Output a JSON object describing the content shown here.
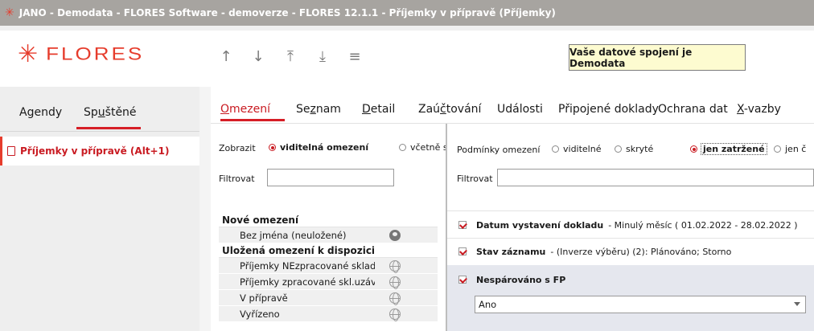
{
  "window": {
    "title": "JANO - Demodata - FLORES Software - demoverze - FLORES 12.1.1 - Příjemky v přípravě  (Příjemky)",
    "icon": "flores-asterisk-icon"
  },
  "header": {
    "logo_text": "FLORES",
    "brand_color": "#e63c2c",
    "nav_icons": [
      "arrow-up-icon",
      "arrow-down-icon",
      "arrow-top-icon",
      "arrow-bottom-icon",
      "menu-icon"
    ],
    "nav_glyphs": [
      "↑",
      "↓",
      "⤒",
      "⤓",
      "≡"
    ],
    "connection_notice": "Vaše datové spojení je Demodata"
  },
  "left": {
    "tabs": [
      {
        "label": "Agendy"
      },
      {
        "label_pre": "Sp",
        "label_u": "u",
        "label_post": "štěné",
        "active": true
      }
    ],
    "items": [
      {
        "label": "Příjemky v přípravě (Alt+1)",
        "icon": "document-icon"
      }
    ]
  },
  "tabs": [
    {
      "pre": "",
      "u": "O",
      "post": "mezení",
      "active": true
    },
    {
      "pre": "Se",
      "u": "z",
      "post": "nam"
    },
    {
      "pre": "",
      "u": "D",
      "post": "etail"
    },
    {
      "pre": "Zaú",
      "u": "č",
      "post": "tování"
    },
    {
      "pre": "Události",
      "u": "",
      "post": ""
    },
    {
      "pre": "Připojené doklady",
      "u": "",
      "post": ""
    },
    {
      "pre": "Ochrana dat",
      "u": "",
      "post": ""
    },
    {
      "pre": "",
      "u": "X",
      "post": "-vazby"
    }
  ],
  "filter_left": {
    "show_label": "Zobrazit",
    "show_options": [
      {
        "label": "viditelná omezení",
        "checked": true
      },
      {
        "label": "včetně s",
        "checked": false
      }
    ],
    "filter_label": "Filtrovat",
    "filter_value": "",
    "new_header": "Nové omezení",
    "new_items": [
      {
        "label": "Bez jména (neuložené)",
        "icon": "user-icon"
      }
    ],
    "saved_header": "Uložená omezení k dispozici",
    "saved_items": [
      {
        "label": "Příjemky NEzpracované sklad",
        "icon": "globe-icon"
      },
      {
        "label": "Příjemky zpracované skl.uzáv",
        "icon": "globe-icon"
      },
      {
        "label": "V přípravě",
        "icon": "globe-icon"
      },
      {
        "label": "Vyřízeno",
        "icon": "globe-icon"
      }
    ]
  },
  "filter_right": {
    "conditions_label": "Podmínky omezení",
    "options": [
      {
        "label": "viditelné",
        "checked": false
      },
      {
        "label": "skryté",
        "checked": false
      },
      {
        "label": "jen zatržené",
        "checked": true
      },
      {
        "label": "jen č",
        "checked": false
      }
    ],
    "filter_label": "Filtrovat",
    "filter_value": "",
    "conditions": [
      {
        "name": "Datum vystavení dokladu",
        "detail": "- Minulý měsíc ( 01.02.2022 - 28.02.2022 )",
        "checked": true
      },
      {
        "name": "Stav záznamu",
        "detail": "- (Inverze výběru) (2): Plánováno; Storno",
        "checked": true
      },
      {
        "name": "Nespárováno s FP",
        "detail": "",
        "checked": true,
        "select_value": "Ano"
      }
    ]
  }
}
